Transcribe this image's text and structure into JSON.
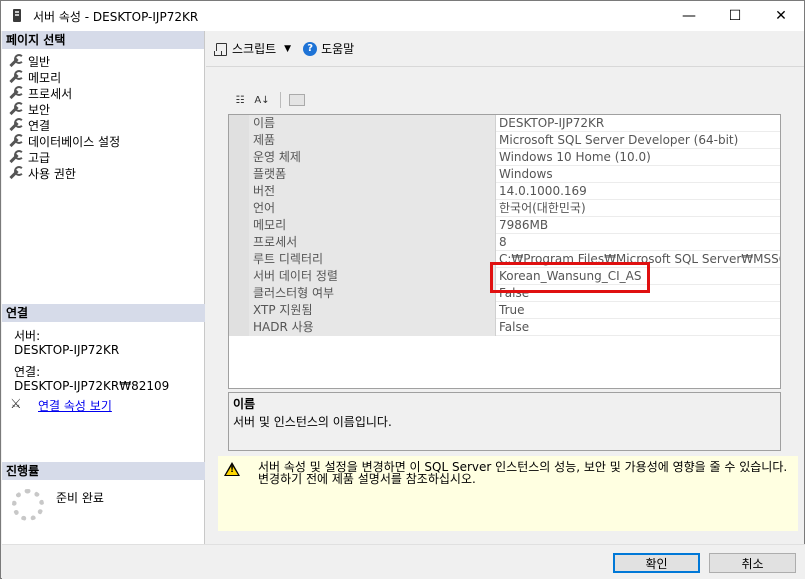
{
  "window": {
    "title": "서버 속성 - DESKTOP-IJP72KR",
    "minimize": "—",
    "maximize": "☐",
    "close": "✕"
  },
  "sidebar": {
    "header": "페이지 선택",
    "items": [
      {
        "label": "일반"
      },
      {
        "label": "메모리"
      },
      {
        "label": "프로세서"
      },
      {
        "label": "보안"
      },
      {
        "label": "연결"
      },
      {
        "label": "데이터베이스 설정"
      },
      {
        "label": "고급"
      },
      {
        "label": "사용 권한"
      }
    ]
  },
  "connection": {
    "header": "연결",
    "server_label": "서버:",
    "server_value": "DESKTOP-IJP72KR",
    "connection_label": "연결:",
    "connection_value": "DESKTOP-IJP72KR₩82109",
    "view_link": "연결 속성 보기"
  },
  "progress": {
    "header": "진행률",
    "status": "준비 완료"
  },
  "toolbar": {
    "script_label": "스크립트",
    "help_label": "도움말"
  },
  "grid": {
    "rows": [
      {
        "name": "이름",
        "value": "DESKTOP-IJP72KR"
      },
      {
        "name": "제품",
        "value": "Microsoft SQL Server Developer (64-bit)"
      },
      {
        "name": "운영 체제",
        "value": "Windows 10 Home (10.0)"
      },
      {
        "name": "플랫폼",
        "value": "Windows"
      },
      {
        "name": "버전",
        "value": "14.0.1000.169"
      },
      {
        "name": "언어",
        "value": "한국어(대한민국)"
      },
      {
        "name": "메모리",
        "value": "7986MB"
      },
      {
        "name": "프로세서",
        "value": "8"
      },
      {
        "name": "루트 디렉터리",
        "value": "C:₩Program Files₩Microsoft SQL Server₩MSSQ"
      },
      {
        "name": "서버 데이터 정렬",
        "value": "Korean_Wansung_CI_AS"
      },
      {
        "name": "클러스터형 여부",
        "value": "False"
      },
      {
        "name": "XTP 지원됨",
        "value": "True"
      },
      {
        "name": "HADR 사용",
        "value": "False"
      }
    ]
  },
  "description": {
    "title": "이름",
    "text": "서버 및 인스턴스의 이름입니다."
  },
  "warning": {
    "text": "서버 속성 및 설정을 변경하면 이 SQL Server 인스턴스의 성능, 보안 및 가용성에 영향을 줄 수 있습니다. 변경하기 전에 제품 설명서를 참조하십시오."
  },
  "buttons": {
    "ok": "확인",
    "cancel": "취소"
  },
  "colors": {
    "section_header": "#d6dbe9",
    "highlight": "#e01010",
    "warning_bg": "#ffffe1",
    "link": "#0000ee"
  }
}
